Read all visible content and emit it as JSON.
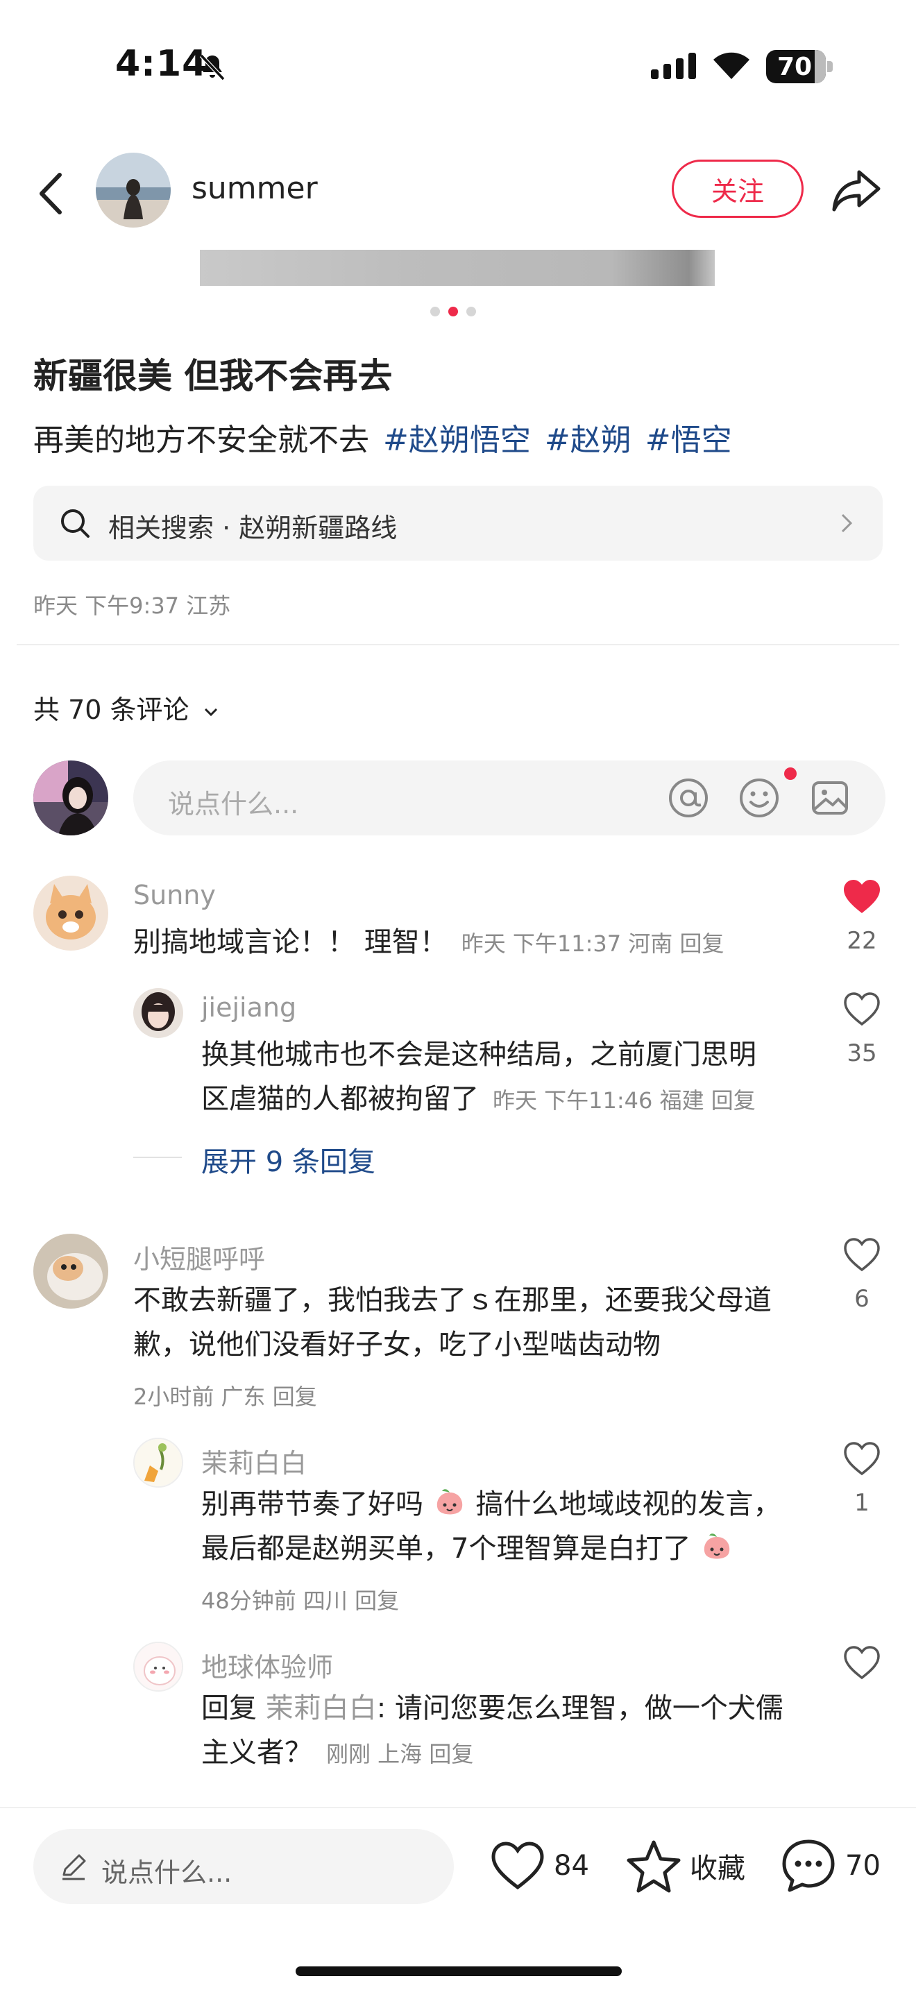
{
  "status": {
    "time": "4:14",
    "battery": "70"
  },
  "header": {
    "username": "summer",
    "follow_label": "关注"
  },
  "post": {
    "title": "新疆很美 但我不会再去",
    "desc": "再美的地方不安全就不去",
    "tags": [
      "#赵朔悟空",
      "#赵朔",
      "#悟空"
    ],
    "related_search": "相关搜索 · 赵朔新疆路线",
    "meta": "昨天 下午9:37 江苏"
  },
  "comments_header": {
    "count_label": "共 70 条评论",
    "input_placeholder": "说点什么..."
  },
  "comments": [
    {
      "name": "Sunny",
      "text": "别搞地域言论！！ 理智！",
      "meta": "昨天 下午11:37 河南 回复",
      "likes": "22",
      "liked": true
    },
    {
      "name": "jiejiang",
      "text_line1": "换其他城市也不会是这种结局，之前厦门思明",
      "text_line2": "区虐猫的人都被拘留了",
      "meta": "昨天 下午11:46 福建 回复",
      "likes": "35"
    },
    {
      "expand_label": "展开 9 条回复"
    },
    {
      "name": "小短腿呼呼",
      "text_line1": "不敢去新疆了，我怕我去了ｓ在那里，还要我父母道",
      "text_line2": "歉，说他们没看好子女，吃了小型啮齿动物",
      "meta": "2小时前 广东 回复",
      "likes": "6"
    },
    {
      "name": "茉莉白白",
      "text_line1": "别再带节奏了好吗",
      "text_line1b": "搞什么地域歧视的发言，",
      "text_line2": "最后都是赵朔买单，7个理智算是白打了",
      "meta": "48分钟前 四川 回复",
      "likes": "1"
    },
    {
      "name": "地球体验师",
      "reply_prefix": "回复 ",
      "reply_to": "茉莉白白",
      "text_line1": ": 请问您要怎么理智，做一个犬儒",
      "text_line2": "主义者？",
      "meta": "刚刚 上海 回复"
    }
  ],
  "bottom": {
    "placeholder": "说点什么...",
    "likes": "84",
    "collect_label": "收藏",
    "comments": "70"
  },
  "colors": {
    "accent": "#ee2a4a",
    "tag": "#1f4a8a"
  }
}
